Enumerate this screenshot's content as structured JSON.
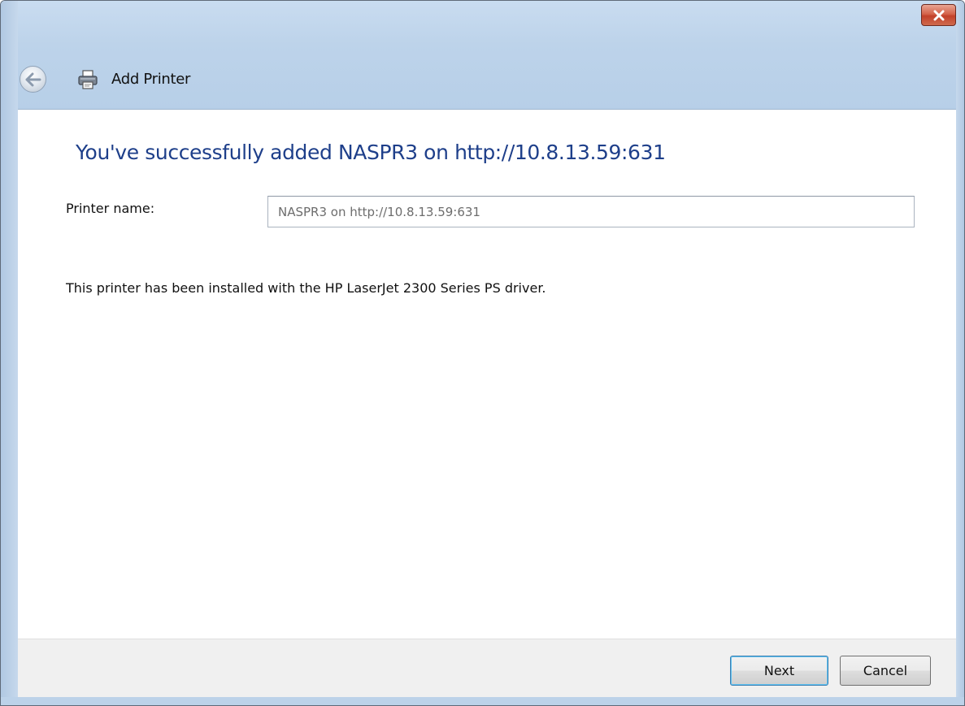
{
  "window": {
    "title": "Add Printer",
    "close_symbol": "✕",
    "back_icon": "back-arrow-icon",
    "title_icon": "printer-icon"
  },
  "main": {
    "heading": "You've successfully added NASPR3 on http://10.8.13.59:631",
    "printer_name_label": "Printer name:",
    "printer_name_value": "NASPR3 on http://10.8.13.59:631",
    "info": "This printer has been installed with the HP LaserJet 2300 Series PS driver."
  },
  "footer": {
    "next_label": "Next",
    "cancel_label": "Cancel"
  },
  "colors": {
    "heading": "#1e3f8a",
    "title_bar": "#bcd3ea",
    "close_button": "#c2412a"
  }
}
